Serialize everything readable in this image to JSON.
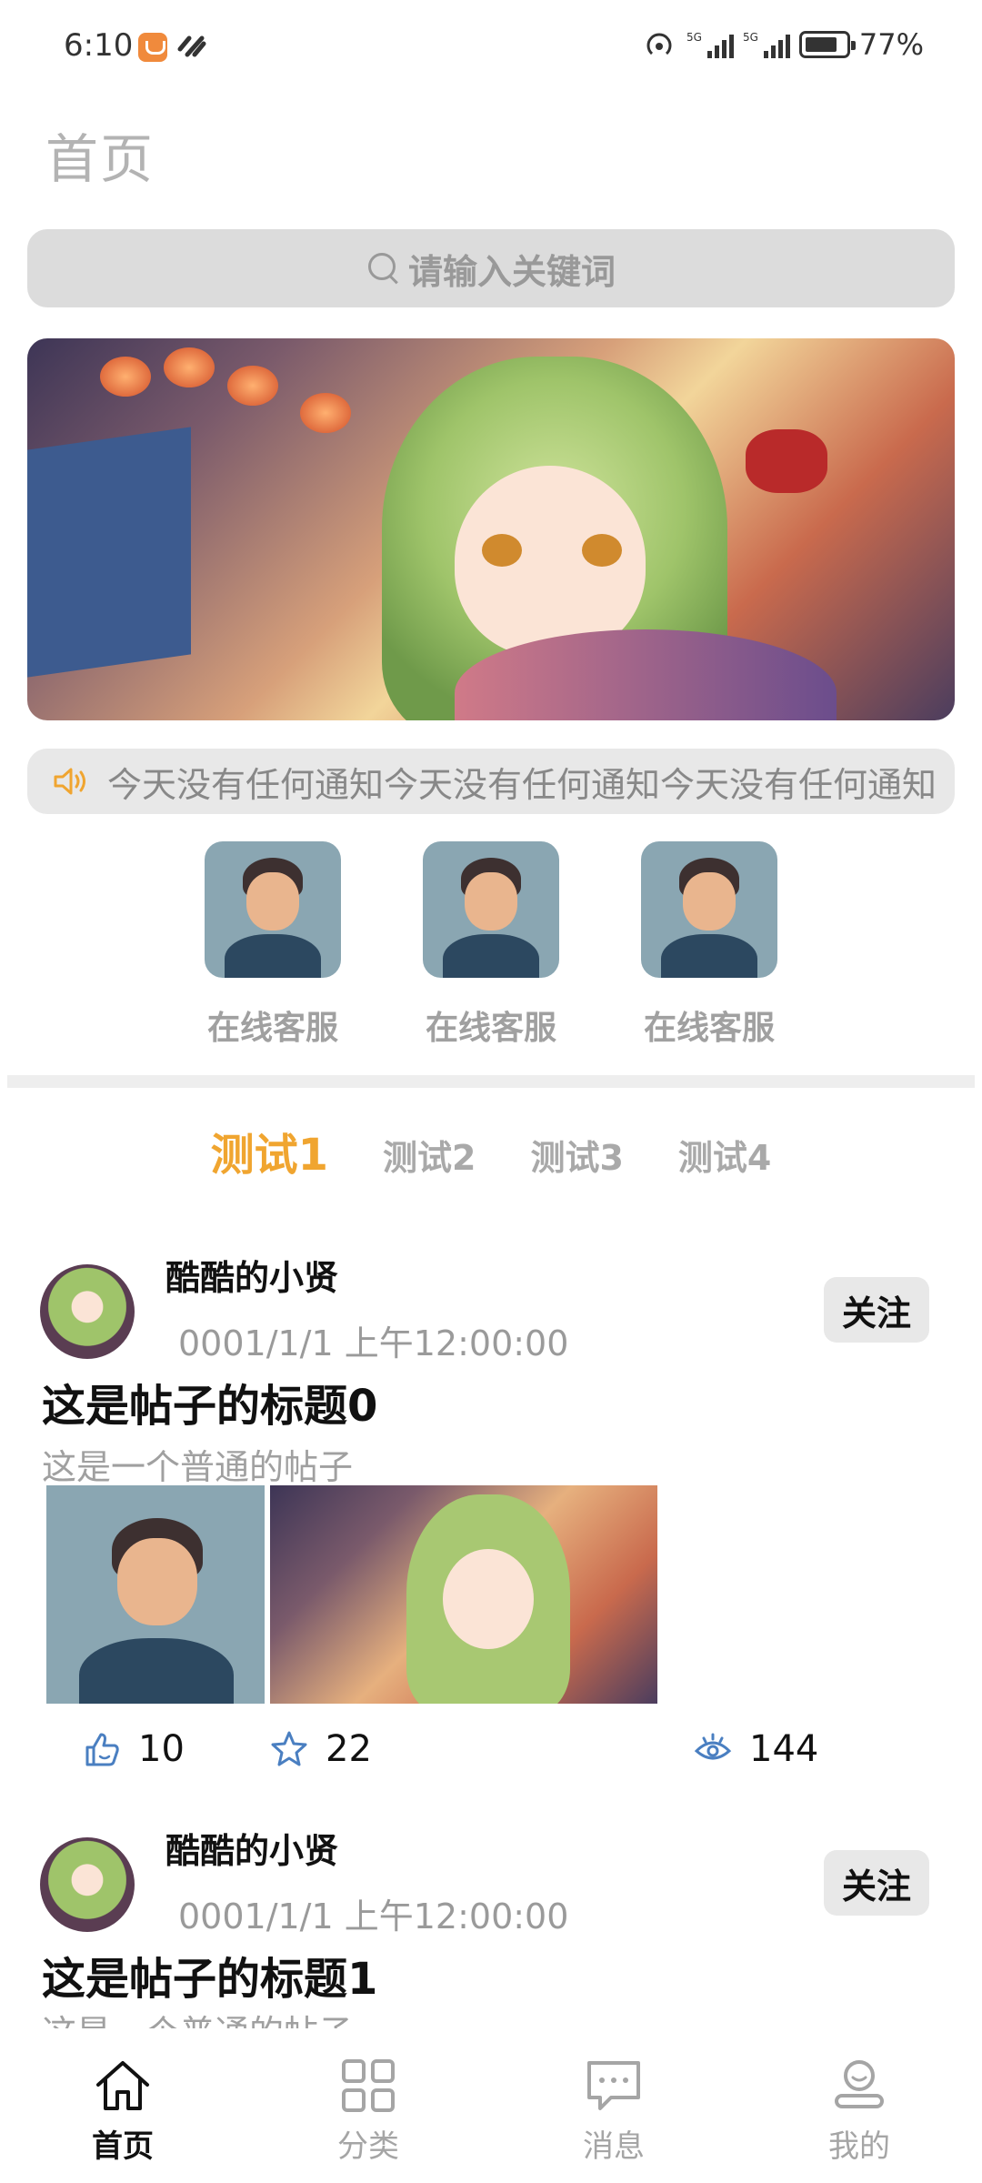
{
  "status_bar": {
    "time": "6:10",
    "battery": "77%"
  },
  "page": {
    "title": "首页"
  },
  "search": {
    "placeholder": "请输入关键词"
  },
  "notice": {
    "text": "今天没有任何通知今天没有任何通知今天没有任何通知"
  },
  "services": [
    {
      "label": "在线客服"
    },
    {
      "label": "在线客服"
    },
    {
      "label": "在线客服"
    }
  ],
  "tabs": [
    {
      "label": "测试1",
      "active": true
    },
    {
      "label": "测试2",
      "active": false
    },
    {
      "label": "测试3",
      "active": false
    },
    {
      "label": "测试4",
      "active": false
    }
  ],
  "posts": [
    {
      "author": "酷酷的小贤",
      "time": "0001/1/1 上午12:00:00",
      "follow_label": "关注",
      "title": "这是帖子的标题0",
      "desc": "这是一个普通的帖子",
      "likes": "10",
      "favorites": "22",
      "views": "144"
    },
    {
      "author": "酷酷的小贤",
      "time": "0001/1/1 上午12:00:00",
      "follow_label": "关注",
      "title": "这是帖子的标题1",
      "desc": "这是一个普通的帖子"
    }
  ],
  "bottom_nav": [
    {
      "label": "首页",
      "icon": "home-icon",
      "active": true
    },
    {
      "label": "分类",
      "icon": "grid-icon",
      "active": false
    },
    {
      "label": "消息",
      "icon": "message-icon",
      "active": false
    },
    {
      "label": "我的",
      "icon": "user-icon",
      "active": false
    }
  ],
  "colors": {
    "accent": "#f0a530",
    "muted": "#a0a0a0",
    "chip_bg": "#e8e8e8"
  }
}
